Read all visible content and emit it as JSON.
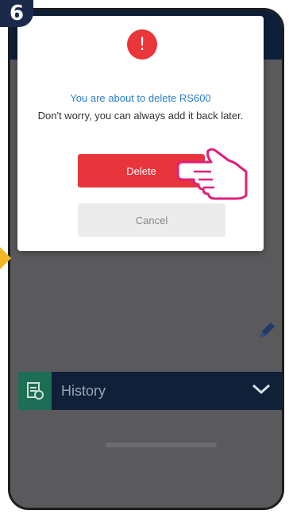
{
  "step": {
    "number": "6"
  },
  "modal": {
    "icon": "exclamation-icon",
    "icon_glyph": "!",
    "title": "You are about to delete RS600",
    "message": "Don't worry, you can always add it back later.",
    "delete_label": "Delete",
    "cancel_label": "Cancel"
  },
  "background": {
    "history_label": "History",
    "edit_icon": "pencil-icon",
    "history_icon": "history-document-icon",
    "chevron_icon": "chevron-down-icon"
  },
  "colors": {
    "accent_red": "#e8343b",
    "title_blue": "#2a7fd0",
    "navy": "#0f2038",
    "highlight_pink": "#e0207a",
    "arrow_yellow": "#f2b824"
  }
}
